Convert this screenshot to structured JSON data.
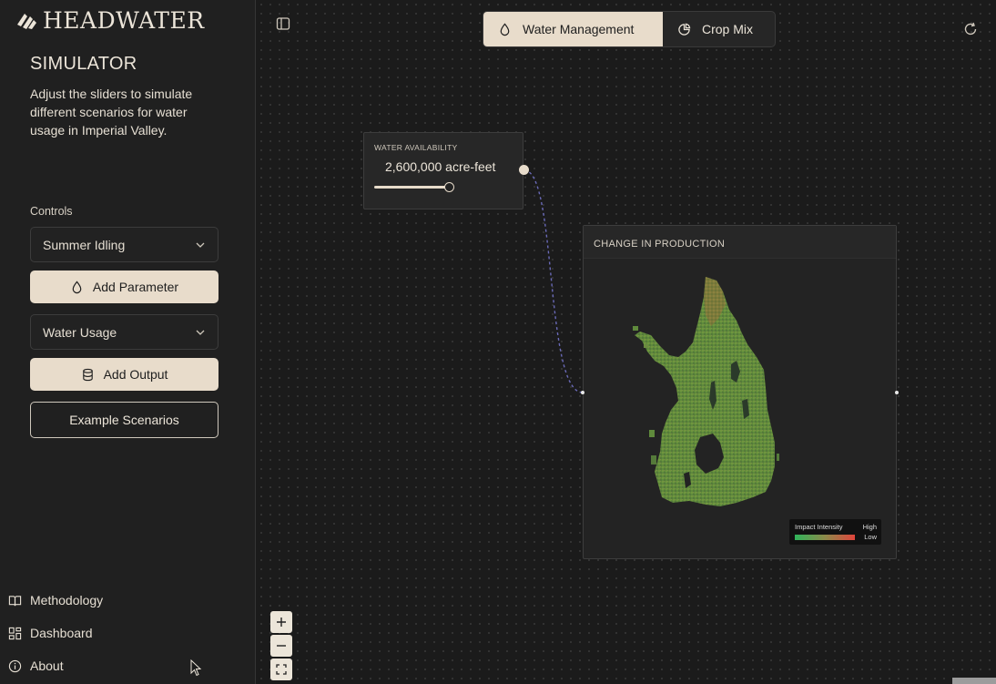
{
  "brand": {
    "name": "HEADWATER"
  },
  "sidebar": {
    "title": "SIMULATOR",
    "description": "Adjust the sliders to simulate different scenarios for water usage in Imperial Valley.",
    "controls_label": "Controls",
    "parameter_select": {
      "value": "Summer Idling"
    },
    "add_parameter_label": "Add Parameter",
    "output_select": {
      "value": "Water Usage"
    },
    "add_output_label": "Add Output",
    "example_scenarios_label": "Example Scenarios",
    "nav": [
      {
        "label": "Methodology",
        "icon": "book-icon"
      },
      {
        "label": "Dashboard",
        "icon": "grid-icon"
      },
      {
        "label": "About",
        "icon": "info-icon"
      }
    ]
  },
  "tabs": [
    {
      "label": "Water Management",
      "icon": "droplet-icon",
      "active": true
    },
    {
      "label": "Crop Mix",
      "icon": "pie-chart-icon",
      "active": false
    }
  ],
  "water_node": {
    "label": "WATER AVAILABILITY",
    "value": "2,600,000 acre-feet",
    "slider_fraction": 0.5
  },
  "production_node": {
    "title": "CHANGE IN PRODUCTION",
    "legend": {
      "title": "Impact Intensity",
      "high": "High",
      "low": "Low"
    }
  },
  "colors": {
    "accent": "#e8dccb",
    "background": "#1b1b1b",
    "sidebar": "#202020",
    "map_low": "#2fb35a",
    "map_high": "#e0443c"
  }
}
